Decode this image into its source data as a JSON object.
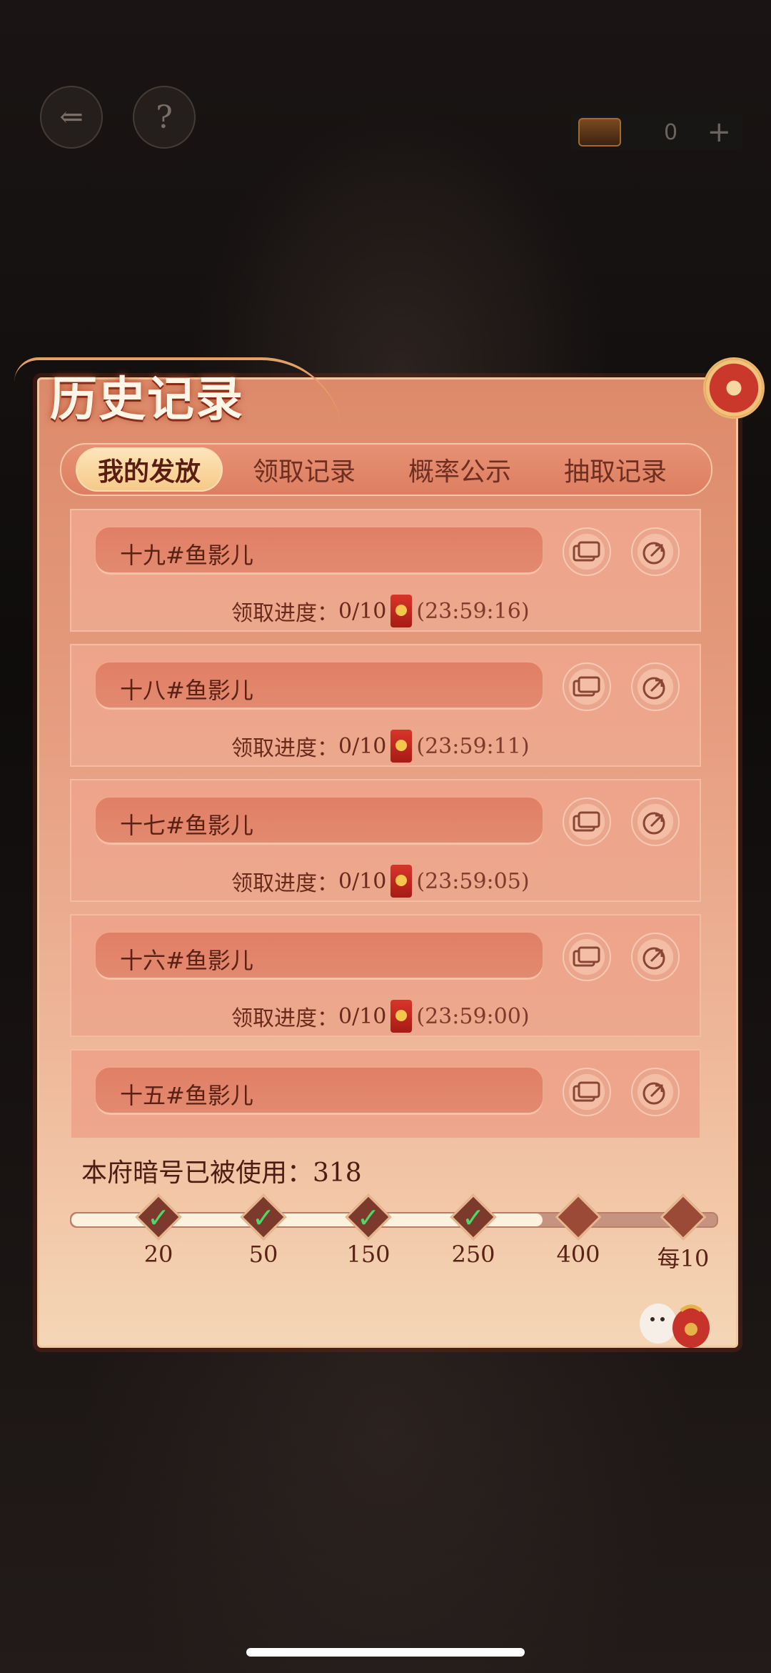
{
  "header": {
    "back_icon": "back-arrow-icon",
    "help_label": "?",
    "coin_value": "0",
    "add_label": "+"
  },
  "panel": {
    "title": "历史记录",
    "tabs": [
      "我的发放",
      "领取记录",
      "概率公示",
      "抽取记录"
    ],
    "active_tab": 0
  },
  "records": [
    {
      "name": "十九#鱼影儿",
      "progress_label": "领取进度：",
      "progress": "0/10",
      "timer": "(23:59:16)"
    },
    {
      "name": "十八#鱼影儿",
      "progress_label": "领取进度：",
      "progress": "0/10",
      "timer": "(23:59:11)"
    },
    {
      "name": "十七#鱼影儿",
      "progress_label": "领取进度：",
      "progress": "0/10",
      "timer": "(23:59:05)"
    },
    {
      "name": "十六#鱼影儿",
      "progress_label": "领取进度：",
      "progress": "0/10",
      "timer": "(23:59:00)"
    },
    {
      "name": "十五#鱼影儿",
      "progress_label": "",
      "progress": "",
      "timer": ""
    }
  ],
  "usage": {
    "label": "本府暗号已被使用：318",
    "progress_fraction": 0.73,
    "milestones": [
      {
        "label": "20",
        "done": true
      },
      {
        "label": "50",
        "done": true
      },
      {
        "label": "150",
        "done": true
      },
      {
        "label": "250",
        "done": true
      },
      {
        "label": "400",
        "done": false
      },
      {
        "label": "每10",
        "done": false
      }
    ]
  },
  "colors": {
    "accent": "#dc8a6a",
    "text_dark": "#5b2114",
    "check": "#4fd86a"
  }
}
